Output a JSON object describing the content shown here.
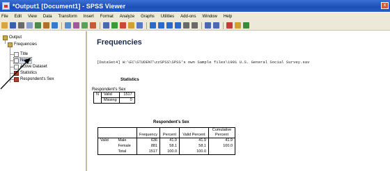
{
  "window": {
    "title": "*Output1 [Document1] - SPSS Viewer",
    "close_glyph": "x"
  },
  "menu": [
    "File",
    "Edit",
    "View",
    "Data",
    "Transform",
    "Insert",
    "Format",
    "Analyze",
    "Graphs",
    "Utilities",
    "Add-ons",
    "Window",
    "Help"
  ],
  "tree": {
    "output": "Output",
    "frequencies": "Frequencies",
    "title": "Title",
    "notes": "Notes",
    "active_dataset": "Active Dataset",
    "statistics": "Statistics",
    "respondents_sex": "Respondent's Sex"
  },
  "content": {
    "heading": "Frequencies",
    "syntax": "[DataSet4] W:\\EC\\STUDENT\\zzSPSS\\SPSS's own Sample files\\1991 U.S. General Social Survey.sav",
    "stats": {
      "title": "Statistics",
      "subtitle": "Respondent's Sex",
      "n_label": "N",
      "valid_label": "Valid",
      "missing_label": "Missing",
      "valid_value": "1517",
      "missing_value": "0"
    },
    "freq": {
      "title": "Respondent's Sex",
      "headers": [
        "Frequency",
        "Percent",
        "Valid Percent",
        "Cumulative Percent"
      ],
      "valid_label": "Valid",
      "rows": [
        {
          "label": "Male",
          "frequency": "636",
          "percent": "41.9",
          "valid_percent": "41.9",
          "cumulative": "41.9"
        },
        {
          "label": "Female",
          "frequency": "881",
          "percent": "58.1",
          "valid_percent": "58.1",
          "cumulative": "100.0"
        },
        {
          "label": "Total",
          "frequency": "1517",
          "percent": "100.0",
          "valid_percent": "100.0",
          "cumulative": ""
        }
      ]
    }
  },
  "colors": {
    "titlebar": "#1d4fb8",
    "chrome": "#ece9d8",
    "heading": "#1a2a4a"
  }
}
